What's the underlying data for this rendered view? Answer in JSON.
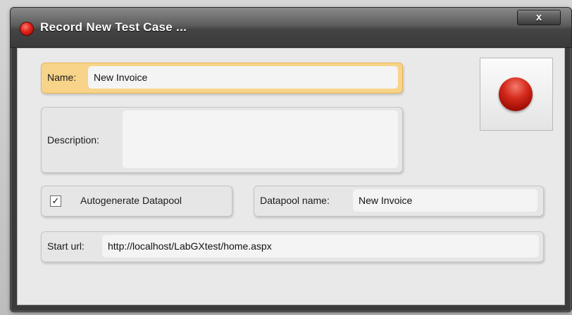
{
  "window": {
    "title": "Record New Test Case ...",
    "close_glyph": "x"
  },
  "form": {
    "name_label": "Name:",
    "name_value": "New Invoice",
    "description_label": "Description:",
    "description_value": "",
    "autogenerate_label": "Autogenerate Datapool",
    "autogenerate_checked": true,
    "check_glyph": "✓",
    "datapool_label": "Datapool name:",
    "datapool_value": "New Invoice",
    "start_url_label": "Start url:",
    "start_url_value": "http://localhost/LabGXtest/home.aspx"
  },
  "icons": {
    "title": "red-dot-icon",
    "record": "record-icon",
    "close": "close-icon",
    "check": "check-icon"
  },
  "colors": {
    "focused_field": "#f8d48a",
    "record_red": "#d42a1b",
    "titlebar": "#444444"
  }
}
